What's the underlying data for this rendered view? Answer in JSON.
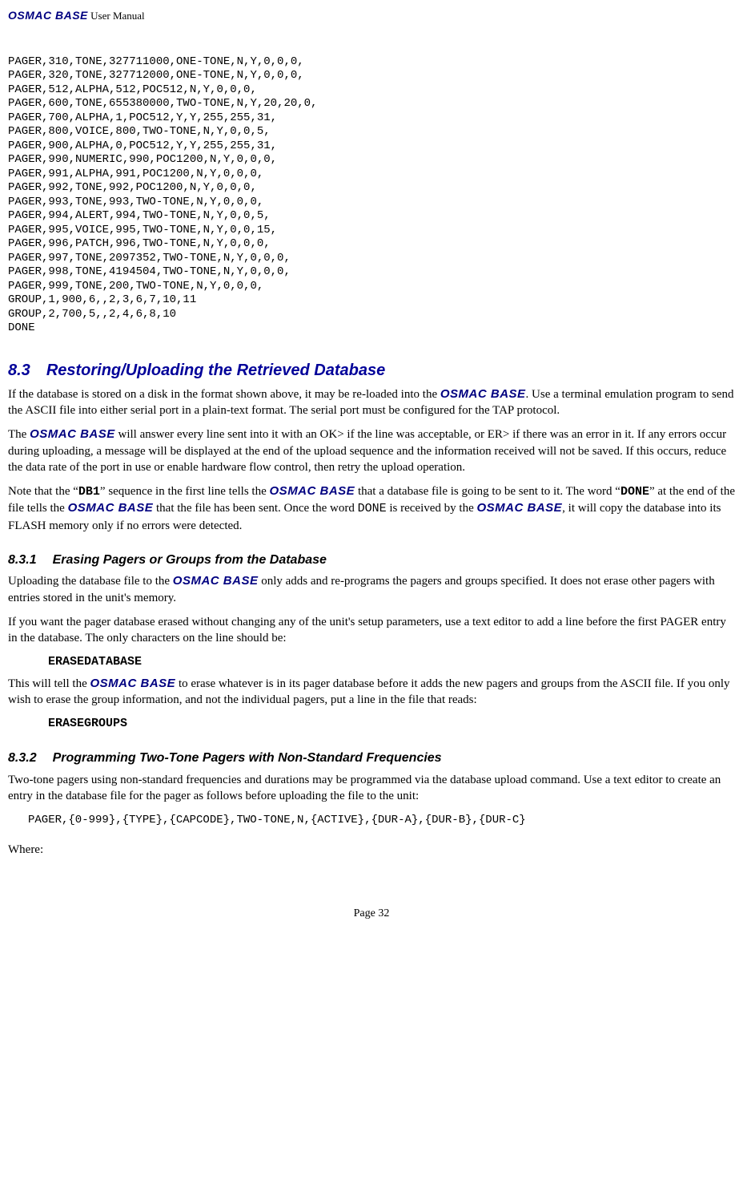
{
  "header": {
    "brand": "OSMAC BASE",
    "suffix": " User Manual"
  },
  "codeblock": "PAGER,310,TONE,327711000,ONE-TONE,N,Y,0,0,0,\nPAGER,320,TONE,327712000,ONE-TONE,N,Y,0,0,0,\nPAGER,512,ALPHA,512,POC512,N,Y,0,0,0,\nPAGER,600,TONE,655380000,TWO-TONE,N,Y,20,20,0,\nPAGER,700,ALPHA,1,POC512,Y,Y,255,255,31,\nPAGER,800,VOICE,800,TWO-TONE,N,Y,0,0,5,\nPAGER,900,ALPHA,0,POC512,Y,Y,255,255,31,\nPAGER,990,NUMERIC,990,POC1200,N,Y,0,0,0,\nPAGER,991,ALPHA,991,POC1200,N,Y,0,0,0,\nPAGER,992,TONE,992,POC1200,N,Y,0,0,0,\nPAGER,993,TONE,993,TWO-TONE,N,Y,0,0,0,\nPAGER,994,ALERT,994,TWO-TONE,N,Y,0,0,5,\nPAGER,995,VOICE,995,TWO-TONE,N,Y,0,0,15,\nPAGER,996,PATCH,996,TWO-TONE,N,Y,0,0,0,\nPAGER,997,TONE,2097352,TWO-TONE,N,Y,0,0,0,\nPAGER,998,TONE,4194504,TWO-TONE,N,Y,0,0,0,\nPAGER,999,TONE,200,TWO-TONE,N,Y,0,0,0,\nGROUP,1,900,6,,2,3,6,7,10,11\nGROUP,2,700,5,,2,4,6,8,10\nDONE",
  "section83": {
    "num": "8.3",
    "title": "Restoring/Uploading the Retrieved Database",
    "p1_a": "If the database is stored on a disk in the format shown above, it may be re-loaded into the ",
    "p1_b": ".  Use a terminal emulation program to send the ASCII file into either serial port in a plain-text format.  The serial port must be configured for the TAP protocol.",
    "p2_a": "The ",
    "p2_b": " will answer every line sent into it with an OK> if the line was acceptable, or ER> if there was an error in it.  If any errors occur during uploading, a message will be displayed at the end of the upload sequence and the information received will not be saved.  If this occurs, reduce the data rate of the port in use or enable hardware flow control, then retry the upload operation.",
    "p3_a": "Note that the “",
    "p3_db1": "DB1",
    "p3_b": "” sequence in the first line tells the ",
    "p3_c": " that a database file is going to be sent to it.  The word “",
    "p3_done": "DONE",
    "p3_d": "” at the end of the file tells the ",
    "p3_e": " that the file has been sent.  Once the word ",
    "p3_done2": "DONE",
    "p3_f": " is received by the ",
    "p3_g": ", it will copy the database into its FLASH memory only if no errors were detected."
  },
  "section831": {
    "num": "8.3.1",
    "title": "Erasing Pagers or Groups from the Database",
    "p1_a": "Uploading the database file to the ",
    "p1_b": " only adds and re-programs the pagers and groups specified.  It does not erase other pagers with entries stored in the unit's memory.",
    "p2": "If you want the pager database erased without changing any of the unit's setup parameters, use a text editor to add a line before the first PAGER entry in the database.  The only characters on the line should be:",
    "code1": "ERASEDATABASE",
    "p3_a": "This will tell the ",
    "p3_b": " to erase whatever is in its pager database before it adds the new pagers and groups from the ASCII file.  If you only wish to erase the group information, and not the individual pagers, put a line in the file that reads:",
    "code2": "ERASEGROUPS"
  },
  "section832": {
    "num": "8.3.2",
    "title": "Programming Two-Tone Pagers with Non-Standard Frequencies",
    "p1": "Two-tone pagers using non-standard frequencies and durations may be programmed via the database upload command.  Use a text editor to create an entry in the database file for the pager as follows before uploading the file to the unit:",
    "code": "PAGER,{0-999},{TYPE},{CAPCODE},TWO-TONE,N,{ACTIVE},{DUR-A},{DUR-B},{DUR-C}",
    "where": "Where:"
  },
  "brand": "OSMAC BASE",
  "footer": "Page 32"
}
